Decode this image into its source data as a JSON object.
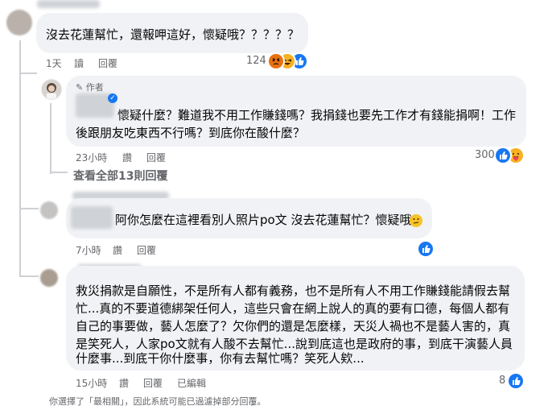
{
  "comments": [
    {
      "text_lines": [
        "沒去花蓮幫忙，還報呷這好，懷疑哦？？？？？"
      ],
      "time": "1天",
      "reply_label": "讀",
      "reply2_label": "回覆",
      "reaction_count": "124",
      "reactions": [
        "angry-icon",
        "haha-icon",
        "like-icon"
      ]
    },
    {
      "badge": "作者",
      "text_lines": [
        "懷疑什麼？難道我不用工作賺錢嗎？我捐錢也要先工作才有錢能捐啊！工作",
        "後跟朋友吃東西不行嗎？到底你在酸什麼？"
      ],
      "time": "23小時",
      "reply_label": "讚",
      "reply2_label": "回覆",
      "reaction_count": "300",
      "reactions": [
        "like-icon",
        "care-icon"
      ]
    },
    {
      "text_lines": [
        "阿你怎麼在這裡看別人照片po文 沒去花蓮幫忙？懷疑哦"
      ],
      "time": "7小時",
      "reply_label": "讚",
      "reply2_label": "回覆",
      "reaction_count": "",
      "reactions": [
        "like-icon"
      ]
    },
    {
      "text_lines": [
        "救災捐款是自願性，不是所有人都有義務，也不是所有人不用工作賺錢能請假去幫",
        "忙...真的不要道德綁架任何人，這些只會在網上說人的真的要有口德，每個人都有",
        "自己的事要做，藝人怎麼了？欠你們的還是怎麼樣，天災人禍也不是藝人害的，真",
        "是笑死人，人家po文就有人酸不去幫忙...說到底這也是政府的事，到底干演藝人員",
        "什麼事...到底干你什麼事，你有去幫忙嗎？笑死人欸..."
      ],
      "time": "15小時",
      "reply_label": "讚",
      "reply2_label": "回覆",
      "edited_label": "已編輯",
      "reaction_count": "8",
      "reactions": [
        "like-icon"
      ]
    }
  ],
  "view_replies": "查看全部13則回覆",
  "footer": "你選擇了「最相關」，因此系統可能已過濾掉部分回覆。",
  "colors": {
    "bubble": "#f0f2f5",
    "meta": "#65676b",
    "like_blue": "#1877f2",
    "angry": "#e9710f",
    "haha": "#f7b125"
  }
}
